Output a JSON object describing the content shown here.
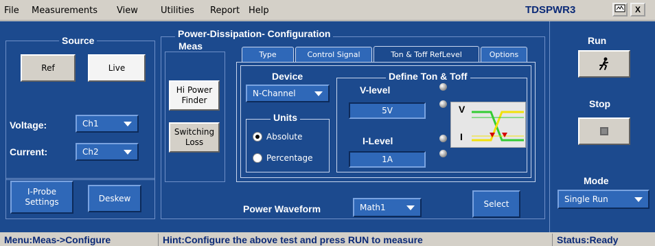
{
  "menu": {
    "items": [
      {
        "label": "File"
      },
      {
        "label": "Measurements"
      },
      {
        "label": "View"
      },
      {
        "label": "Utilities"
      },
      {
        "label": "Report"
      },
      {
        "label": "Help"
      }
    ],
    "app_title": "TDSPWR3",
    "minimize_label": "▣",
    "close_label": "X"
  },
  "source": {
    "title": "Source",
    "ref_label": "Ref",
    "live_label": "Live",
    "voltage_label": "Voltage:",
    "voltage_value": "Ch1",
    "current_label": "Current:",
    "current_value": "Ch2"
  },
  "buttons": {
    "iprobe_label": "I-Probe\nSettings",
    "deskew_label": "Deskew"
  },
  "config": {
    "title": "Power-Dissipation- Configuration",
    "meas_title": "Meas",
    "hipower_label": "Hi Power Finder",
    "switching_label": "Switching Loss",
    "tabs": [
      {
        "label": "Type"
      },
      {
        "label": "Control Signal"
      },
      {
        "label": "Ton & Toff RefLevel"
      },
      {
        "label": "Options"
      }
    ],
    "device_label": "Device",
    "device_value": "N-Channel",
    "units_label": "Units",
    "units_options": [
      {
        "label": "Absolute",
        "selected": true
      },
      {
        "label": "Percentage",
        "selected": false
      }
    ],
    "define_title": "Define Ton & Toff",
    "vlevel_label": "V-level",
    "vlevel_value": "5V",
    "ilevel_label": "I-Level",
    "ilevel_value": "1A",
    "diagram_v": "V",
    "diagram_i": "I",
    "power_waveform_label": "Power Waveform",
    "power_waveform_value": "Math1",
    "select_label": "Select"
  },
  "run": {
    "run_label": "Run",
    "stop_label": "Stop",
    "mode_label": "Mode",
    "mode_value": "Single Run"
  },
  "status": {
    "menu_text": "Menu:Meas->Configure",
    "hint_text": "Hint:Configure the above test and press RUN to measure",
    "status_text": "Status:Ready"
  },
  "colors": {
    "panel_bg": "#1c4a8e",
    "button_blue": "#2f68b8",
    "title_text": "#0b2a77",
    "trace_green": "#33cc33",
    "trace_yellow": "#f2e20a",
    "marker_red": "#d40000"
  }
}
